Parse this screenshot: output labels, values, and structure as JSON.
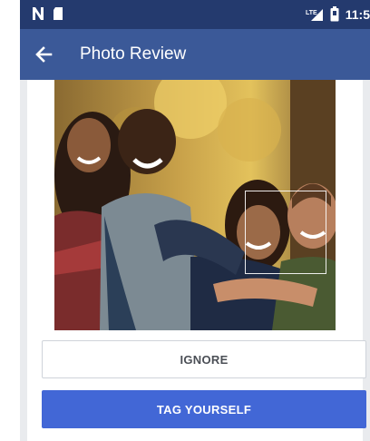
{
  "status_bar": {
    "time": "11:5",
    "network_label": "LTE",
    "icons": [
      "n-logo-icon",
      "sd-card-icon",
      "signal-icon",
      "battery-icon"
    ]
  },
  "app_bar": {
    "title": "Photo Review",
    "back_icon": "arrow-left-icon"
  },
  "photo": {
    "alt": "Group of friends smiling outdoors",
    "face_highlight": "face-detection-box"
  },
  "actions": {
    "ignore_label": "IGNORE",
    "tag_label": "TAG YOURSELF"
  },
  "colors": {
    "status_bar": "#243a6e",
    "app_bar": "#3b5998",
    "primary_button": "#4267d6"
  }
}
